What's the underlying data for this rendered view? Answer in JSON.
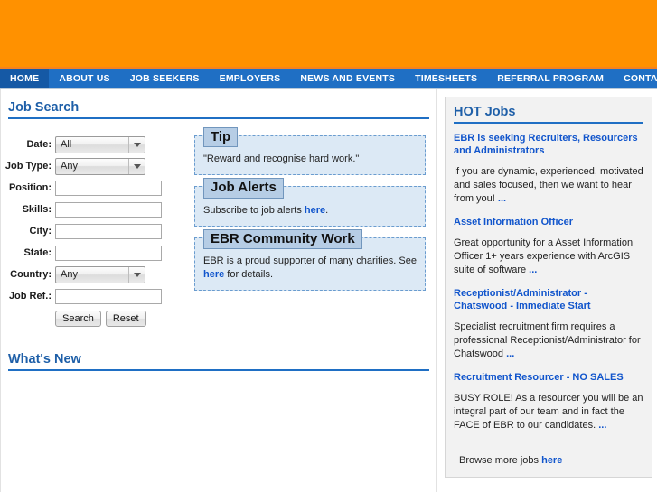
{
  "theme": {
    "banner_color": "#FF9100",
    "nav_color": "#1F6FC4",
    "nav_active_color": "#1559A5",
    "heading_color": "#1E5FA8",
    "link_color": "#1155CC",
    "infobox_bg": "#DCE9F5",
    "infobox_title_bg": "#B6CDE5",
    "sidebar_bg": "#F2F2F2"
  },
  "nav": {
    "items": [
      {
        "label": "HOME",
        "active": true
      },
      {
        "label": "ABOUT US",
        "active": false
      },
      {
        "label": "JOB SEEKERS",
        "active": false
      },
      {
        "label": "EMPLOYERS",
        "active": false
      },
      {
        "label": "NEWS AND EVENTS",
        "active": false
      },
      {
        "label": "TIMESHEETS",
        "active": false
      },
      {
        "label": "REFERRAL PROGRAM",
        "active": false
      },
      {
        "label": "CONTACT US",
        "active": false
      }
    ]
  },
  "job_search": {
    "title": "Job Search",
    "fields": [
      {
        "label": "Date:",
        "type": "select",
        "value": "All"
      },
      {
        "label": "Job Type:",
        "type": "select",
        "value": "Any"
      },
      {
        "label": "Position:",
        "type": "text",
        "value": ""
      },
      {
        "label": "Skills:",
        "type": "text",
        "value": ""
      },
      {
        "label": "City:",
        "type": "text",
        "value": ""
      },
      {
        "label": "State:",
        "type": "text",
        "value": ""
      },
      {
        "label": "Country:",
        "type": "select",
        "value": "Any"
      },
      {
        "label": "Job Ref.:",
        "type": "text",
        "value": ""
      }
    ],
    "search_button": "Search",
    "reset_button": "Reset"
  },
  "info_boxes": [
    {
      "title": "Tip",
      "body_pre": "\"Reward and recognise hard work.\"",
      "link": "",
      "body_post": ""
    },
    {
      "title": "Job Alerts",
      "body_pre": "Subscribe to job alerts ",
      "link": "here",
      "body_post": "."
    },
    {
      "title": "EBR Community Work",
      "body_pre": "EBR is a proud supporter of many charities. See ",
      "link": "here",
      "body_post": " for details."
    }
  ],
  "whats_new": {
    "title": "What's New"
  },
  "hot_jobs": {
    "title": "HOT Jobs",
    "jobs": [
      {
        "title": "EBR is seeking Recruiters, Resourcers and Administrators",
        "description": "If you are dynamic, experienced, motivated and sales focused, then we want to hear from you!",
        "more": "..."
      },
      {
        "title": "Asset Information Officer",
        "description": "Great opportunity for a Asset Information Officer 1+ years experience with ArcGIS suite of software",
        "more": "..."
      },
      {
        "title": "Receptionist/Administrator - Chatswood - Immediate Start",
        "description": "Specialist recruitment firm requires a professional Receptionist/Administrator for Chatswood",
        "more": "..."
      },
      {
        "title": "Recruitment Resourcer - NO SALES",
        "description": "BUSY ROLE! As a resourcer you will be an integral part of our team and in fact the FACE of EBR to our candidates.",
        "more": "..."
      }
    ],
    "browse_text": "Browse more jobs ",
    "browse_link": "here"
  }
}
